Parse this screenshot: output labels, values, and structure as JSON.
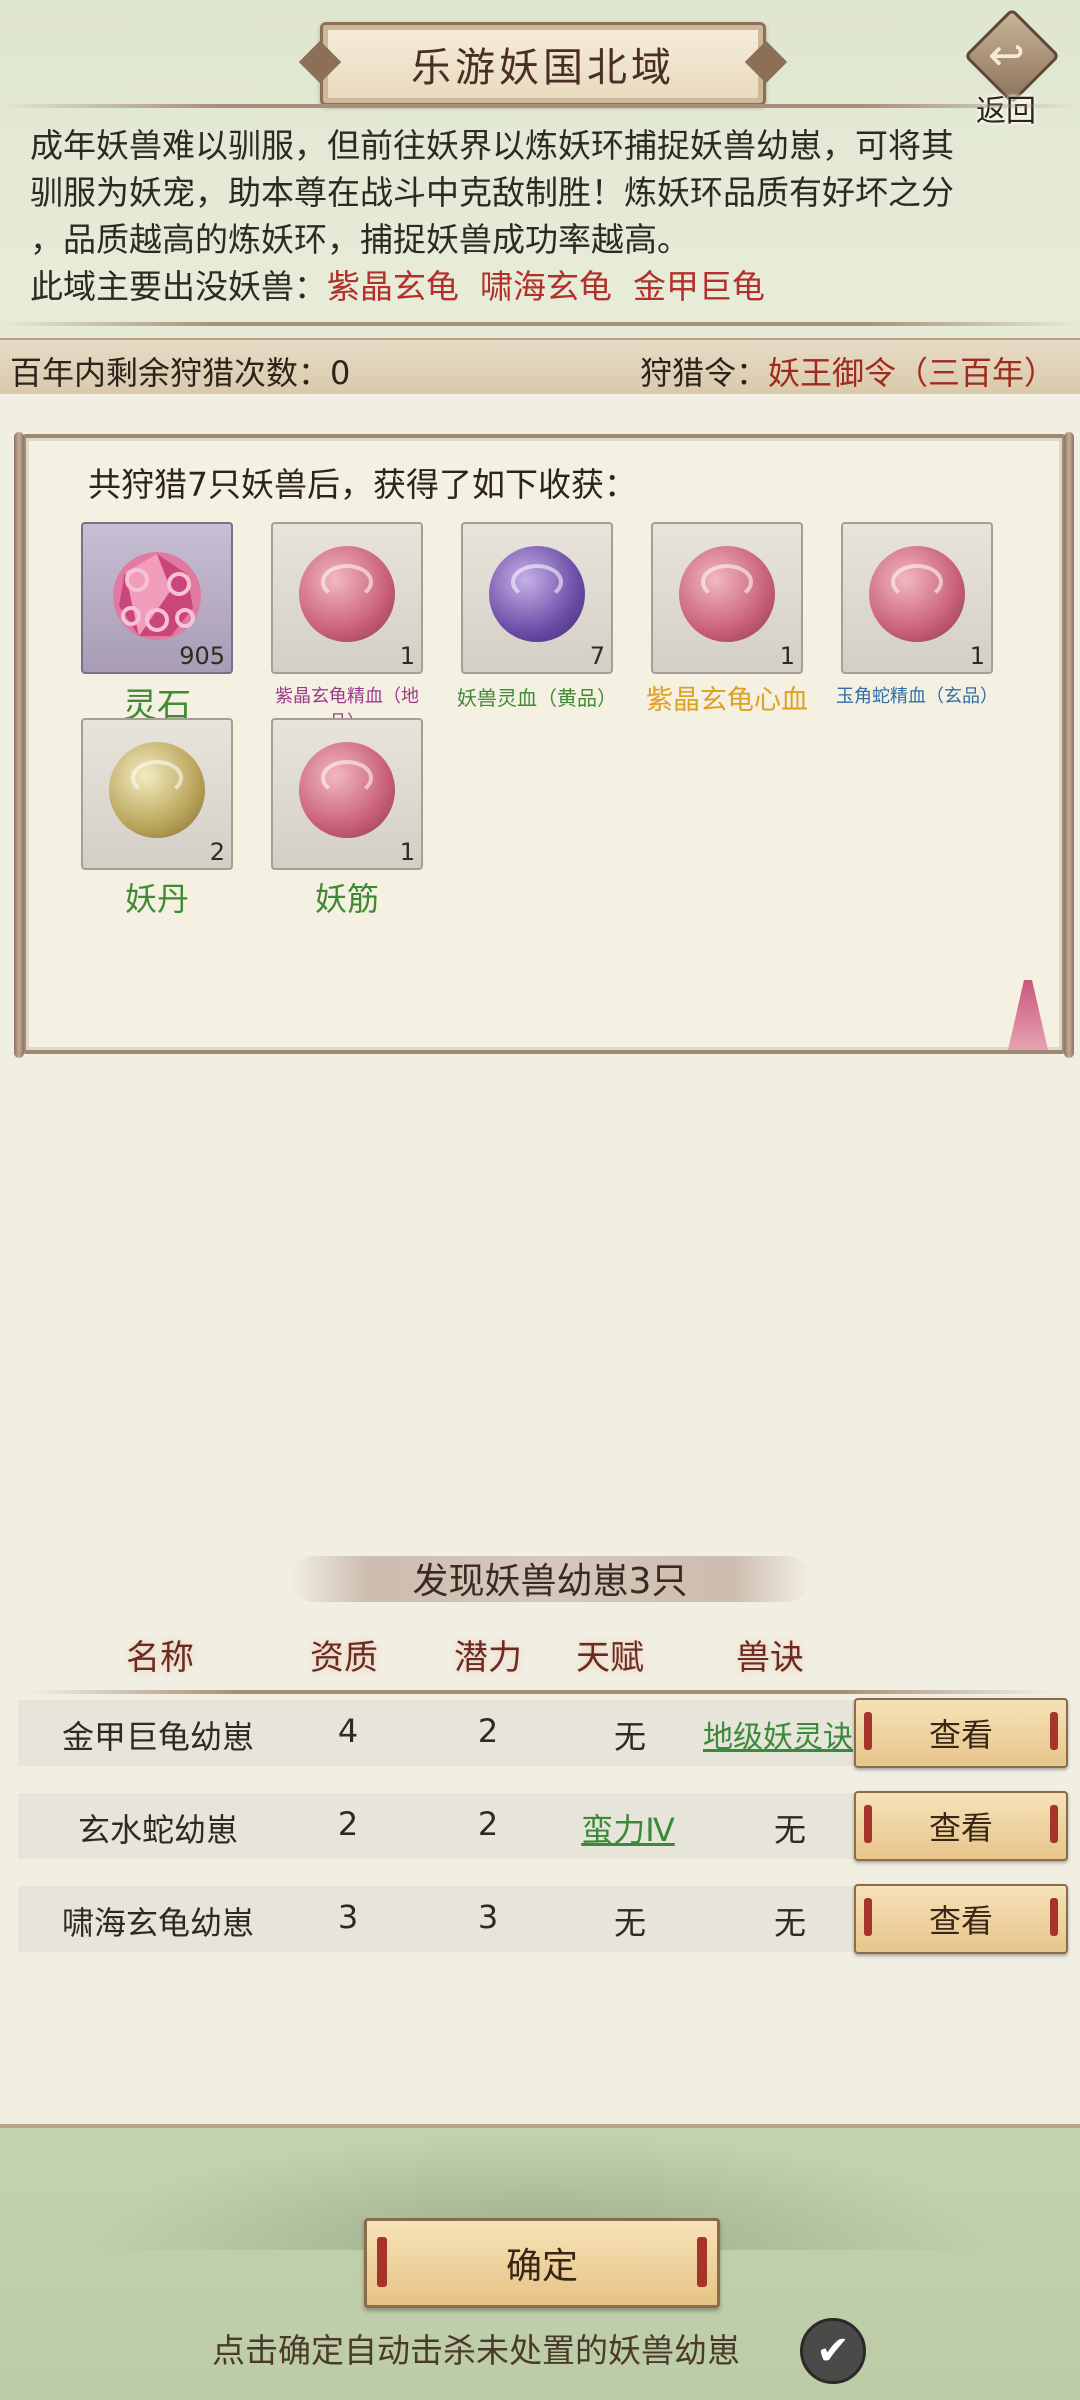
{
  "header": {
    "title": "乐游妖国北域",
    "back_label": "返回"
  },
  "intro": {
    "line1": "成年妖兽难以驯服，但前往妖界以炼妖环捕捉妖兽幼崽，可将其",
    "line2": "驯服为妖宠，助本尊在战斗中克敌制胜！炼妖环品质有好坏之分",
    "line3": "，品质越高的炼妖环，捕捉妖兽成功率越高。",
    "beasts_label": "此域主要出没妖兽：",
    "beasts": "紫晶玄龟  啸海玄龟  金甲巨龟"
  },
  "info_bar": {
    "remaining": "百年内剩余狩猎次数：0",
    "token_label": "狩猎令：",
    "token_value": "妖王御令（三百年）"
  },
  "harvest": {
    "title": "共狩猎7只妖兽后，获得了如下收获：",
    "items": [
      {
        "name": "灵石",
        "qty": "905",
        "name_color": "#3f8a33",
        "icon": "pink-crystal-icon"
      },
      {
        "name": "紫晶玄龟精血（地品）",
        "qty": "1",
        "name_color": "#9b3a8c",
        "icon": "pink-orb-icon"
      },
      {
        "name": "妖兽灵血（黄品）",
        "qty": "7",
        "name_color": "#3f8a33",
        "icon": "purple-orb-icon"
      },
      {
        "name": "紫晶玄龟心血",
        "qty": "1",
        "name_color": "#e0a020",
        "icon": "pink-orb-icon"
      },
      {
        "name": "玉角蛇精血（玄品）",
        "qty": "1",
        "name_color": "#2f6ea8",
        "icon": "pink-orb-icon"
      },
      {
        "name": "妖丹",
        "qty": "2",
        "name_color": "#3f8a33",
        "icon": "gold-orb-icon"
      },
      {
        "name": "妖筋",
        "qty": "1",
        "name_color": "#3f8a33",
        "icon": "pink-orb-icon"
      }
    ]
  },
  "found": {
    "title": "发现妖兽幼崽3只",
    "columns": [
      "名称",
      "资质",
      "潜力",
      "天赋",
      "兽诀"
    ],
    "rows": [
      {
        "name": "金甲巨龟幼崽",
        "aptitude": "4",
        "potential": "2",
        "talent": "无",
        "skill": "地级妖灵诀",
        "action": "查看"
      },
      {
        "name": "玄水蛇幼崽",
        "aptitude": "2",
        "potential": "2",
        "talent": "蛮力Ⅳ",
        "skill": "无",
        "action": "查看"
      },
      {
        "name": "啸海玄龟幼崽",
        "aptitude": "3",
        "potential": "3",
        "talent": "无",
        "skill": "无",
        "action": "查看"
      }
    ]
  },
  "footer": {
    "confirm_label": "确定",
    "hint": "点击确定自动击杀未处置的妖兽幼崽",
    "auto_kill_checked": true
  }
}
